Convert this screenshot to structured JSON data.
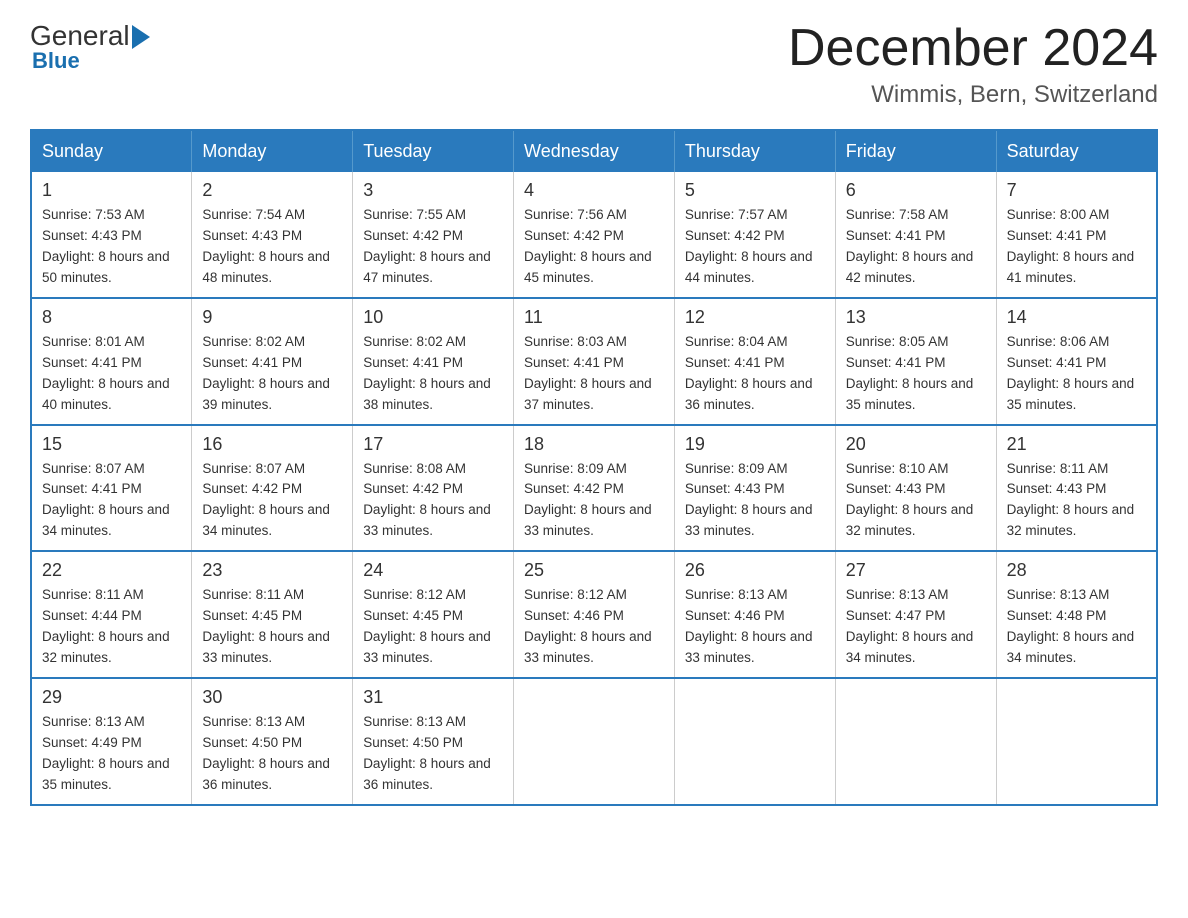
{
  "header": {
    "logo_general": "General",
    "logo_blue": "Blue",
    "month_title": "December 2024",
    "location": "Wimmis, Bern, Switzerland"
  },
  "weekdays": [
    "Sunday",
    "Monday",
    "Tuesday",
    "Wednesday",
    "Thursday",
    "Friday",
    "Saturday"
  ],
  "weeks": [
    [
      {
        "day": "1",
        "sunrise": "7:53 AM",
        "sunset": "4:43 PM",
        "daylight": "8 hours and 50 minutes."
      },
      {
        "day": "2",
        "sunrise": "7:54 AM",
        "sunset": "4:43 PM",
        "daylight": "8 hours and 48 minutes."
      },
      {
        "day": "3",
        "sunrise": "7:55 AM",
        "sunset": "4:42 PM",
        "daylight": "8 hours and 47 minutes."
      },
      {
        "day": "4",
        "sunrise": "7:56 AM",
        "sunset": "4:42 PM",
        "daylight": "8 hours and 45 minutes."
      },
      {
        "day": "5",
        "sunrise": "7:57 AM",
        "sunset": "4:42 PM",
        "daylight": "8 hours and 44 minutes."
      },
      {
        "day": "6",
        "sunrise": "7:58 AM",
        "sunset": "4:41 PM",
        "daylight": "8 hours and 42 minutes."
      },
      {
        "day": "7",
        "sunrise": "8:00 AM",
        "sunset": "4:41 PM",
        "daylight": "8 hours and 41 minutes."
      }
    ],
    [
      {
        "day": "8",
        "sunrise": "8:01 AM",
        "sunset": "4:41 PM",
        "daylight": "8 hours and 40 minutes."
      },
      {
        "day": "9",
        "sunrise": "8:02 AM",
        "sunset": "4:41 PM",
        "daylight": "8 hours and 39 minutes."
      },
      {
        "day": "10",
        "sunrise": "8:02 AM",
        "sunset": "4:41 PM",
        "daylight": "8 hours and 38 minutes."
      },
      {
        "day": "11",
        "sunrise": "8:03 AM",
        "sunset": "4:41 PM",
        "daylight": "8 hours and 37 minutes."
      },
      {
        "day": "12",
        "sunrise": "8:04 AM",
        "sunset": "4:41 PM",
        "daylight": "8 hours and 36 minutes."
      },
      {
        "day": "13",
        "sunrise": "8:05 AM",
        "sunset": "4:41 PM",
        "daylight": "8 hours and 35 minutes."
      },
      {
        "day": "14",
        "sunrise": "8:06 AM",
        "sunset": "4:41 PM",
        "daylight": "8 hours and 35 minutes."
      }
    ],
    [
      {
        "day": "15",
        "sunrise": "8:07 AM",
        "sunset": "4:41 PM",
        "daylight": "8 hours and 34 minutes."
      },
      {
        "day": "16",
        "sunrise": "8:07 AM",
        "sunset": "4:42 PM",
        "daylight": "8 hours and 34 minutes."
      },
      {
        "day": "17",
        "sunrise": "8:08 AM",
        "sunset": "4:42 PM",
        "daylight": "8 hours and 33 minutes."
      },
      {
        "day": "18",
        "sunrise": "8:09 AM",
        "sunset": "4:42 PM",
        "daylight": "8 hours and 33 minutes."
      },
      {
        "day": "19",
        "sunrise": "8:09 AM",
        "sunset": "4:43 PM",
        "daylight": "8 hours and 33 minutes."
      },
      {
        "day": "20",
        "sunrise": "8:10 AM",
        "sunset": "4:43 PM",
        "daylight": "8 hours and 32 minutes."
      },
      {
        "day": "21",
        "sunrise": "8:11 AM",
        "sunset": "4:43 PM",
        "daylight": "8 hours and 32 minutes."
      }
    ],
    [
      {
        "day": "22",
        "sunrise": "8:11 AM",
        "sunset": "4:44 PM",
        "daylight": "8 hours and 32 minutes."
      },
      {
        "day": "23",
        "sunrise": "8:11 AM",
        "sunset": "4:45 PM",
        "daylight": "8 hours and 33 minutes."
      },
      {
        "day": "24",
        "sunrise": "8:12 AM",
        "sunset": "4:45 PM",
        "daylight": "8 hours and 33 minutes."
      },
      {
        "day": "25",
        "sunrise": "8:12 AM",
        "sunset": "4:46 PM",
        "daylight": "8 hours and 33 minutes."
      },
      {
        "day": "26",
        "sunrise": "8:13 AM",
        "sunset": "4:46 PM",
        "daylight": "8 hours and 33 minutes."
      },
      {
        "day": "27",
        "sunrise": "8:13 AM",
        "sunset": "4:47 PM",
        "daylight": "8 hours and 34 minutes."
      },
      {
        "day": "28",
        "sunrise": "8:13 AM",
        "sunset": "4:48 PM",
        "daylight": "8 hours and 34 minutes."
      }
    ],
    [
      {
        "day": "29",
        "sunrise": "8:13 AM",
        "sunset": "4:49 PM",
        "daylight": "8 hours and 35 minutes."
      },
      {
        "day": "30",
        "sunrise": "8:13 AM",
        "sunset": "4:50 PM",
        "daylight": "8 hours and 36 minutes."
      },
      {
        "day": "31",
        "sunrise": "8:13 AM",
        "sunset": "4:50 PM",
        "daylight": "8 hours and 36 minutes."
      },
      null,
      null,
      null,
      null
    ]
  ]
}
